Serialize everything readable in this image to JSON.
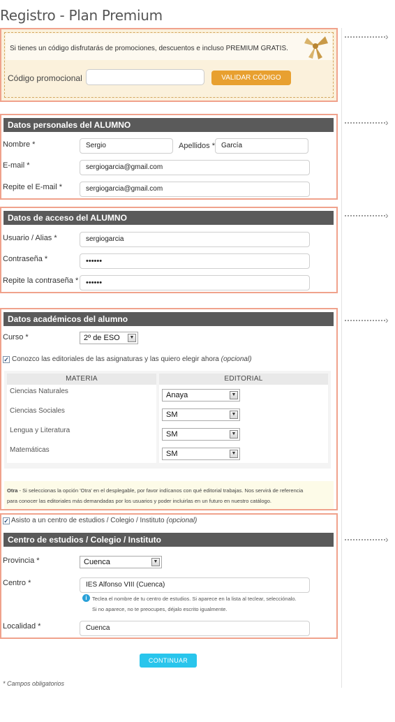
{
  "page": {
    "title": "Registro - Plan Premium"
  },
  "promo": {
    "text": "Si tienes un código disfrutarás de promociones, descuentos e incluso PREMIUM GRATIS.",
    "label": "Código promocional",
    "input_value": "",
    "button_label": "VALIDAR CÓDIGO",
    "decoration_icon": "gift-bow-icon"
  },
  "personal": {
    "title": "Datos personales del ALUMNO",
    "nombre_label": "Nombre *",
    "nombre_value": "Sergio",
    "apellidos_label": "Apellidos *",
    "apellidos_value": "García",
    "email_label": "E-mail *",
    "email_value": "sergiogarcia@gmail.com",
    "email2_label": "Repite el E-mail *",
    "email2_value": "sergiogarcia@gmail.com"
  },
  "access": {
    "title": "Datos de acceso del ALUMNO",
    "user_label": "Usuario / Alias *",
    "user_value": "sergiogarcia",
    "pass_label": "Contraseña *",
    "pass_value": "••••••",
    "pass2_label": "Repite la contraseña *",
    "pass2_value": "••••••"
  },
  "academic": {
    "title": "Datos académicos del alumno",
    "curso_label": "Curso *",
    "curso_value": "2º de ESO",
    "editorials_checkbox_checked": true,
    "editorials_checkbox_label": "Conozco las editoriales de las asignaturas y las quiero elegir ahora",
    "optional": "(opcional)",
    "col_materia": "MATERIA",
    "col_editorial": "EDITORIAL",
    "rows": [
      {
        "materia": "Ciencias Naturales",
        "editorial": "Anaya"
      },
      {
        "materia": "Ciencias Sociales",
        "editorial": "SM"
      },
      {
        "materia": "Lengua y Literatura",
        "editorial": "SM"
      },
      {
        "materia": "Matemáticas",
        "editorial": "SM"
      }
    ],
    "note_bold": "Otra",
    "note_line1": " - Si seleccionas la opción 'Otra' en el desplegable, por favor indícanos con qué editorial trabajas. Nos servirá de referencia",
    "note_line2": "para conocer las editoriales más demandadas por los usuarios y poder incluirlas en un futuro en nuestro catálogo."
  },
  "school": {
    "checkbox_checked": true,
    "checkbox_label": "Asisto a un centro de estudios / Colegio / Instituto",
    "optional": "(opcional)",
    "title": "Centro de estudios / Colegio / Instituto",
    "provincia_label": "Provincia *",
    "provincia_value": "Cuenca",
    "centro_label": "Centro *",
    "centro_value": "IES Alfonso VIII (Cuenca)",
    "hint_line1": "Teclea el nombre de tu centro de estudios. Si aparece en la lista al teclear, selecciónalo.",
    "hint_line2": "Si no aparece, no te preocupes, déjalo escrito igualmente.",
    "localidad_label": "Localidad *",
    "localidad_value": "Cuenca"
  },
  "actions": {
    "continue_label": "CONTINUAR"
  },
  "footer": {
    "required_note": "* Campos obligatorios"
  }
}
